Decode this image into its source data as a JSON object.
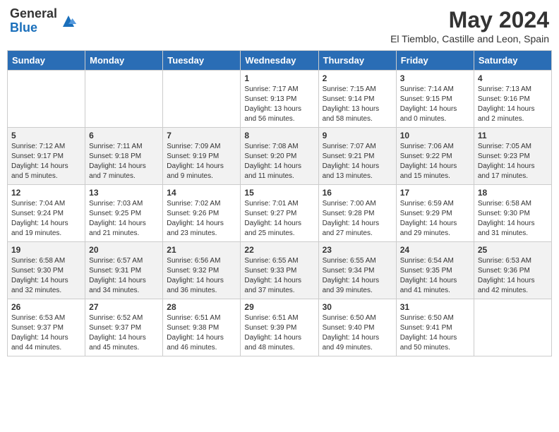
{
  "header": {
    "logo_general": "General",
    "logo_blue": "Blue",
    "month_year": "May 2024",
    "location": "El Tiemblo, Castille and Leon, Spain"
  },
  "days_of_week": [
    "Sunday",
    "Monday",
    "Tuesday",
    "Wednesday",
    "Thursday",
    "Friday",
    "Saturday"
  ],
  "weeks": [
    [
      {
        "day": "",
        "info": ""
      },
      {
        "day": "",
        "info": ""
      },
      {
        "day": "",
        "info": ""
      },
      {
        "day": "1",
        "info": "Sunrise: 7:17 AM\nSunset: 9:13 PM\nDaylight: 13 hours\nand 56 minutes."
      },
      {
        "day": "2",
        "info": "Sunrise: 7:15 AM\nSunset: 9:14 PM\nDaylight: 13 hours\nand 58 minutes."
      },
      {
        "day": "3",
        "info": "Sunrise: 7:14 AM\nSunset: 9:15 PM\nDaylight: 14 hours\nand 0 minutes."
      },
      {
        "day": "4",
        "info": "Sunrise: 7:13 AM\nSunset: 9:16 PM\nDaylight: 14 hours\nand 2 minutes."
      }
    ],
    [
      {
        "day": "5",
        "info": "Sunrise: 7:12 AM\nSunset: 9:17 PM\nDaylight: 14 hours\nand 5 minutes."
      },
      {
        "day": "6",
        "info": "Sunrise: 7:11 AM\nSunset: 9:18 PM\nDaylight: 14 hours\nand 7 minutes."
      },
      {
        "day": "7",
        "info": "Sunrise: 7:09 AM\nSunset: 9:19 PM\nDaylight: 14 hours\nand 9 minutes."
      },
      {
        "day": "8",
        "info": "Sunrise: 7:08 AM\nSunset: 9:20 PM\nDaylight: 14 hours\nand 11 minutes."
      },
      {
        "day": "9",
        "info": "Sunrise: 7:07 AM\nSunset: 9:21 PM\nDaylight: 14 hours\nand 13 minutes."
      },
      {
        "day": "10",
        "info": "Sunrise: 7:06 AM\nSunset: 9:22 PM\nDaylight: 14 hours\nand 15 minutes."
      },
      {
        "day": "11",
        "info": "Sunrise: 7:05 AM\nSunset: 9:23 PM\nDaylight: 14 hours\nand 17 minutes."
      }
    ],
    [
      {
        "day": "12",
        "info": "Sunrise: 7:04 AM\nSunset: 9:24 PM\nDaylight: 14 hours\nand 19 minutes."
      },
      {
        "day": "13",
        "info": "Sunrise: 7:03 AM\nSunset: 9:25 PM\nDaylight: 14 hours\nand 21 minutes."
      },
      {
        "day": "14",
        "info": "Sunrise: 7:02 AM\nSunset: 9:26 PM\nDaylight: 14 hours\nand 23 minutes."
      },
      {
        "day": "15",
        "info": "Sunrise: 7:01 AM\nSunset: 9:27 PM\nDaylight: 14 hours\nand 25 minutes."
      },
      {
        "day": "16",
        "info": "Sunrise: 7:00 AM\nSunset: 9:28 PM\nDaylight: 14 hours\nand 27 minutes."
      },
      {
        "day": "17",
        "info": "Sunrise: 6:59 AM\nSunset: 9:29 PM\nDaylight: 14 hours\nand 29 minutes."
      },
      {
        "day": "18",
        "info": "Sunrise: 6:58 AM\nSunset: 9:30 PM\nDaylight: 14 hours\nand 31 minutes."
      }
    ],
    [
      {
        "day": "19",
        "info": "Sunrise: 6:58 AM\nSunset: 9:30 PM\nDaylight: 14 hours\nand 32 minutes."
      },
      {
        "day": "20",
        "info": "Sunrise: 6:57 AM\nSunset: 9:31 PM\nDaylight: 14 hours\nand 34 minutes."
      },
      {
        "day": "21",
        "info": "Sunrise: 6:56 AM\nSunset: 9:32 PM\nDaylight: 14 hours\nand 36 minutes."
      },
      {
        "day": "22",
        "info": "Sunrise: 6:55 AM\nSunset: 9:33 PM\nDaylight: 14 hours\nand 37 minutes."
      },
      {
        "day": "23",
        "info": "Sunrise: 6:55 AM\nSunset: 9:34 PM\nDaylight: 14 hours\nand 39 minutes."
      },
      {
        "day": "24",
        "info": "Sunrise: 6:54 AM\nSunset: 9:35 PM\nDaylight: 14 hours\nand 41 minutes."
      },
      {
        "day": "25",
        "info": "Sunrise: 6:53 AM\nSunset: 9:36 PM\nDaylight: 14 hours\nand 42 minutes."
      }
    ],
    [
      {
        "day": "26",
        "info": "Sunrise: 6:53 AM\nSunset: 9:37 PM\nDaylight: 14 hours\nand 44 minutes."
      },
      {
        "day": "27",
        "info": "Sunrise: 6:52 AM\nSunset: 9:37 PM\nDaylight: 14 hours\nand 45 minutes."
      },
      {
        "day": "28",
        "info": "Sunrise: 6:51 AM\nSunset: 9:38 PM\nDaylight: 14 hours\nand 46 minutes."
      },
      {
        "day": "29",
        "info": "Sunrise: 6:51 AM\nSunset: 9:39 PM\nDaylight: 14 hours\nand 48 minutes."
      },
      {
        "day": "30",
        "info": "Sunrise: 6:50 AM\nSunset: 9:40 PM\nDaylight: 14 hours\nand 49 minutes."
      },
      {
        "day": "31",
        "info": "Sunrise: 6:50 AM\nSunset: 9:41 PM\nDaylight: 14 hours\nand 50 minutes."
      },
      {
        "day": "",
        "info": ""
      }
    ]
  ]
}
